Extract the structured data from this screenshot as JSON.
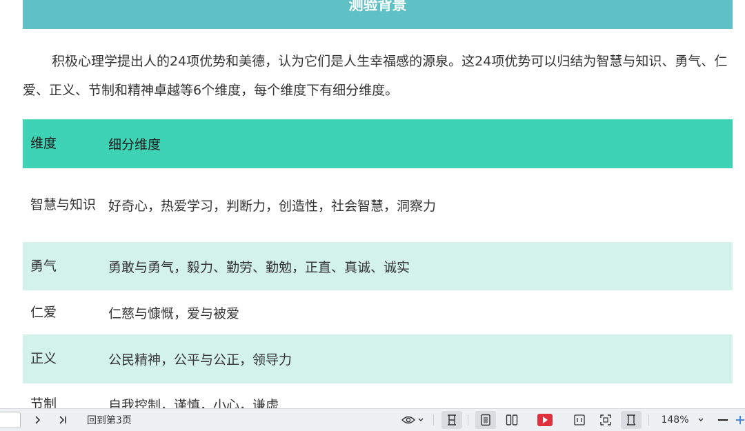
{
  "banner": {
    "title": "测验背景"
  },
  "intro": "积极心理学提出人的24项优势和美德，认为它们是人生幸福感的源泉。这24项优势可以归结为智慧与知识、勇气、仁爱、正义、节制和精神卓越等6个维度，每个维度下有细分维度。",
  "table": {
    "headers": [
      "维度",
      "细分维度"
    ],
    "rows": [
      {
        "dimension": "智慧与知识",
        "sub": "好奇心，热爱学习，判断力，创造性，社会智慧，洞察力"
      },
      {
        "dimension": "勇气",
        "sub": "勇敢与勇气，毅力、勤劳、勤勉，正直、真诚、诚实"
      },
      {
        "dimension": "仁爱",
        "sub": "仁慈与慷慨，爱与被爱"
      },
      {
        "dimension": "正义",
        "sub": "公民精神，公平与公正，领导力"
      },
      {
        "dimension": "节制",
        "sub": "自我控制，谨慎，小心，谦虚"
      }
    ]
  },
  "toolbar": {
    "back_to_page": "回到第3页",
    "zoom": "148%",
    "next_icon": "chevron-right-icon",
    "last_icon": "last-page-icon",
    "eye_icon": "eye-icon",
    "colors": {
      "bar": "#eef1f4",
      "play": "#e0303e"
    }
  }
}
